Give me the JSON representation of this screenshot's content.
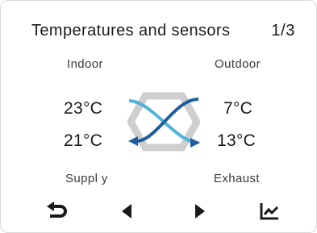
{
  "header": {
    "title": "Temperatures and sensors",
    "page_indicator": "1/3"
  },
  "labels": {
    "indoor": "Indoor",
    "outdoor": "Outdoor",
    "supply": "Suppl y",
    "exhaust": "Exhaust"
  },
  "temperatures": {
    "indoor": "23°C",
    "outdoor": "7°C",
    "supply": "21°C",
    "exhaust": "13°C"
  },
  "colors": {
    "cold_flow": "#1f5e9e",
    "warm_flow": "#4fb3d9",
    "exchanger": "#cfcfcf",
    "icons": "#1a1a1a"
  },
  "nav": {
    "icons": [
      "back-icon",
      "previous-icon",
      "next-icon",
      "chart-icon"
    ]
  }
}
